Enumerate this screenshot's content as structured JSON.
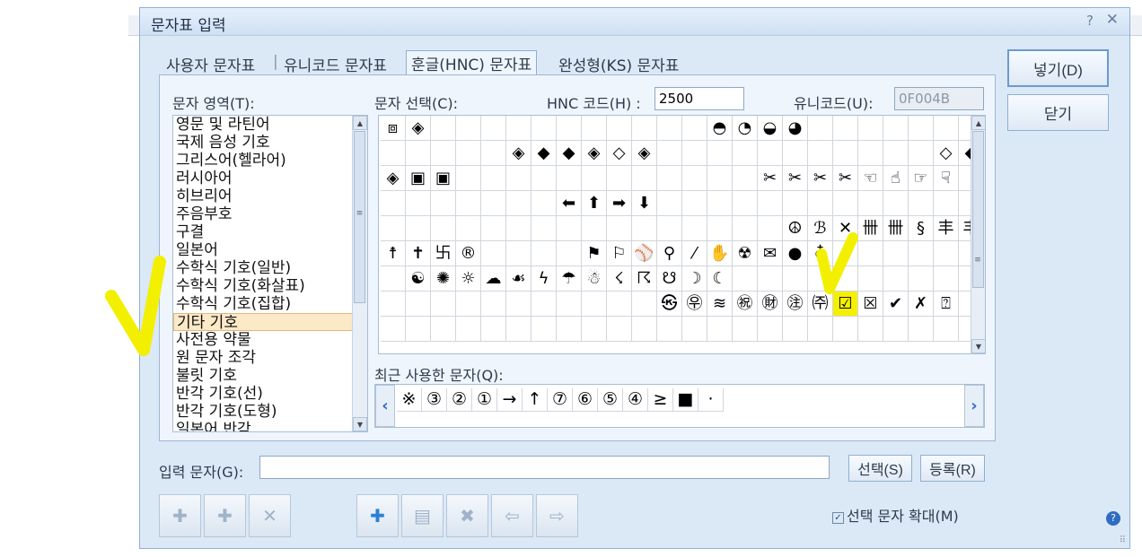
{
  "window": {
    "title": "문자표 입력",
    "help_glyph": "?",
    "close_glyph": "✕"
  },
  "tabs": [
    {
      "label": "사용자 문자표",
      "active": false
    },
    {
      "label": "유니코드 문자표",
      "active": false
    },
    {
      "label": "훈글(HNC) 문자표",
      "active": true
    },
    {
      "label": "완성형(KS) 문자표",
      "active": false
    }
  ],
  "tab_separator": "|",
  "char_area": {
    "label": "문자 영역(T):",
    "items": [
      "영문 및 라틴어",
      "국제 음성 기호",
      "그리스어(헬라어)",
      "러시아어",
      "히브리어",
      "주음부호",
      "구결",
      "일본어",
      "수학식 기호(일반)",
      "수학식 기호(화살표)",
      "수학식 기호(집합)",
      "기타 기호",
      "사전용 약물",
      "원 문자 조각",
      "불릿 기호",
      "반각 기호(선)",
      "반각 기호(도형)",
      "일본어 반각"
    ],
    "selected": "기타 기호"
  },
  "char_select": {
    "label": "문자 선택(C):",
    "hnc_label": "HNC 코드(H) :",
    "hnc_value": "2500",
    "unicode_label": "유니코드(U):",
    "unicode_value": "0F004B",
    "rows": [
      [
        "⧈",
        "◈",
        "",
        "",
        "",
        "",
        "",
        "",
        "",
        "",
        "",
        "",
        "",
        "◓",
        "◔",
        "◒",
        "◕",
        "",
        "",
        "",
        "",
        "",
        "",
        "",
        ""
      ],
      [
        "",
        "",
        "",
        "",
        "",
        "◈",
        "◆",
        "◆",
        "◈",
        "◇",
        "◈",
        "",
        "",
        "",
        "",
        "",
        "",
        "",
        "",
        "",
        "",
        "",
        "◇",
        "◆",
        "◆"
      ],
      [
        "◈",
        "▣",
        "▣",
        "",
        "",
        "",
        "",
        "",
        "",
        "",
        "",
        "",
        "",
        "",
        "",
        "✂",
        "✂",
        "✂",
        "✂",
        "☜",
        "☝",
        "☞",
        "☟",
        "",
        ""
      ],
      [
        "",
        "",
        "",
        "",
        "",
        "",
        "",
        "⬅",
        "⬆",
        "➡",
        "⬇",
        "",
        "",
        "",
        "",
        "",
        "",
        "",
        "",
        "",
        "",
        "",
        "",
        "",
        ""
      ],
      [
        "",
        "",
        "",
        "",
        "",
        "",
        "",
        "",
        "",
        "",
        "",
        "",
        "",
        "",
        "",
        "",
        "☮",
        "ℬ",
        "✕",
        "卌",
        "卌",
        "§",
        "丰",
        "丰",
        ""
      ],
      [
        "☨",
        "✝",
        "卐",
        "®",
        "",
        "",
        "",
        "",
        "⚑",
        "⚐",
        "⚾",
        "⚲",
        "⁄",
        "✋",
        "☢",
        "✉",
        "●",
        "♁",
        "",
        "",
        "",
        "",
        "",
        "",
        ""
      ],
      [
        "",
        "☯",
        "✺",
        "☼",
        "☁",
        "☙",
        "ϟ",
        "☂",
        "☃",
        "☇",
        "☈",
        "☋",
        "☽",
        "☾",
        "",
        "",
        "",
        "",
        "",
        "",
        "",
        "",
        "",
        "",
        ""
      ],
      [
        "",
        "",
        "",
        "",
        "",
        "",
        "",
        "",
        "",
        "",
        "",
        "㉿",
        "㉾",
        "≋",
        "㊗",
        "㊖",
        "㊟",
        "㈜",
        "☑",
        "☒",
        "✔",
        "✗",
        "⍰",
        "",
        ""
      ],
      [
        "",
        "",
        "",
        "",
        "",
        "",
        "",
        "",
        "",
        "",
        "",
        "",
        "",
        "",
        "",
        "",
        "",
        "",
        "",
        "",
        "",
        "",
        "",
        "",
        ""
      ]
    ],
    "highlight": "☑",
    "scroll": {
      "up": "▲",
      "down": "▼",
      "grip": "≡"
    }
  },
  "recent": {
    "label": "최근 사용한 문자(Q):",
    "chars": [
      "※",
      "③",
      "②",
      "①",
      "→",
      "↑",
      "⑦",
      "⑥",
      "⑤",
      "④",
      "≥",
      "■",
      "·"
    ],
    "prev": "‹",
    "next": "›"
  },
  "input": {
    "label": "입력 문자(G):",
    "value": ""
  },
  "buttons": {
    "insert": "넣기(D)",
    "close": "닫기",
    "select": "선택(S)",
    "register": "등록(R)"
  },
  "toolbar": {
    "group1": [
      "✚",
      "✚",
      "✕"
    ],
    "group2": [
      "✚",
      "▤",
      "✖",
      "⇦",
      "⇨"
    ]
  },
  "enlarge": {
    "label": "선택 문자 확대(M)",
    "checked": true,
    "check_glyph": "✓"
  },
  "help_icon": "?",
  "grip": "⠿"
}
